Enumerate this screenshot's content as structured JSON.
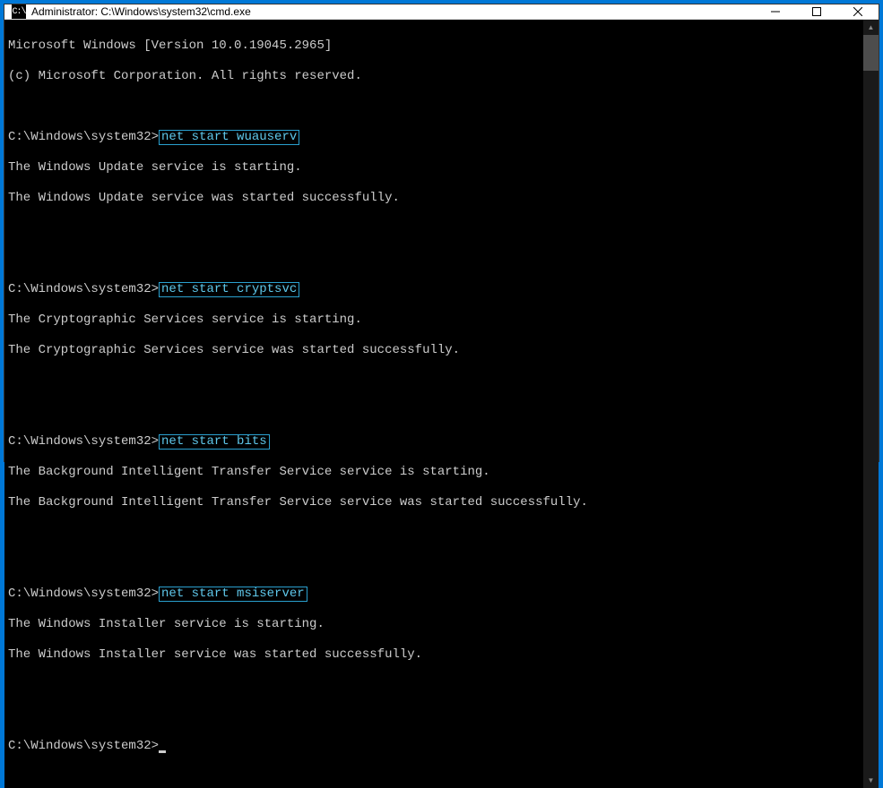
{
  "window": {
    "icon_text": "C:\\",
    "title": "Administrator: C:\\Windows\\system32\\cmd.exe"
  },
  "header": {
    "line1": "Microsoft Windows [Version 10.0.19045.2965]",
    "line2": "(c) Microsoft Corporation. All rights reserved."
  },
  "prompt_path": "C:\\Windows\\system32>",
  "blocks": [
    {
      "command": "net start wuauserv",
      "out1": "The Windows Update service is starting.",
      "out2": "The Windows Update service was started successfully."
    },
    {
      "command": "net start cryptsvc",
      "out1": "The Cryptographic Services service is starting.",
      "out2": "The Cryptographic Services service was started successfully."
    },
    {
      "command": "net start bits",
      "out1": "The Background Intelligent Transfer Service service is starting.",
      "out2": "The Background Intelligent Transfer Service service was started successfully."
    },
    {
      "command": "net start msiserver",
      "out1": "The Windows Installer service is starting.",
      "out2": "The Windows Installer service was started successfully."
    }
  ],
  "colors": {
    "highlight_border": "#2aa0cf",
    "highlight_text": "#5fc8eb",
    "terminal_fg": "#cccccc",
    "terminal_bg": "#000000",
    "window_accent": "#0078d7"
  }
}
